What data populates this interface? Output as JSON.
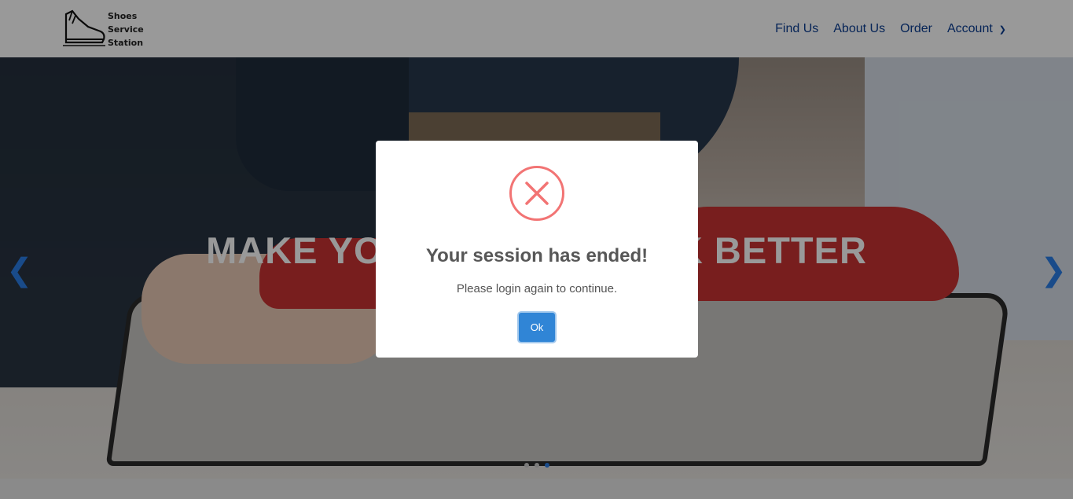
{
  "brand": {
    "logo_lines": [
      "Shoes",
      "Service",
      "Station"
    ]
  },
  "nav": {
    "items": [
      {
        "label": "Find Us"
      },
      {
        "label": "About Us"
      },
      {
        "label": "Order"
      },
      {
        "label": "Account"
      }
    ],
    "link_color": "#0a3d91"
  },
  "hero": {
    "headline": "MAKE YOUR SHOES LOOK BETTER",
    "active_slide": 3,
    "slide_count": 3,
    "accent_color": "#2a7ee6"
  },
  "modal": {
    "title": "Your session has ended!",
    "message": "Please login again to continue.",
    "ok_label": "Ok",
    "icon": "error-x-icon",
    "icon_color": "#f27474",
    "button_color": "#3085d6"
  }
}
